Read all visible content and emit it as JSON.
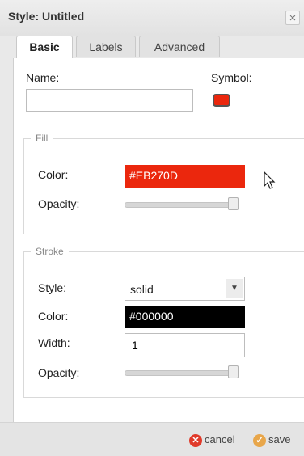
{
  "window": {
    "title": "Style: Untitled",
    "close_glyph": "×"
  },
  "tabs": [
    {
      "label": "Basic",
      "active": true
    },
    {
      "label": "Labels",
      "active": false
    },
    {
      "label": "Advanced",
      "active": false
    }
  ],
  "basic": {
    "name_label": "Name:",
    "name_value": "",
    "symbol_label": "Symbol:",
    "symbol_color": "#EB270D"
  },
  "fill": {
    "legend": "Fill",
    "color_label": "Color:",
    "color_value": "#EB270D",
    "opacity_label": "Opacity:",
    "opacity": 1.0
  },
  "stroke": {
    "legend": "Stroke",
    "style_label": "Style:",
    "style_value": "solid",
    "color_label": "Color:",
    "color_value": "#000000",
    "width_label": "Width:",
    "width_value": "1",
    "opacity_label": "Opacity:",
    "opacity": 1.0
  },
  "footer": {
    "cancel_label": "cancel",
    "save_label": "save"
  },
  "icons": {
    "close": "close-icon",
    "dropdown": "chevron-down-icon",
    "cancel": "cancel-icon",
    "save": "save-icon",
    "cursor": "mouse-cursor-icon"
  }
}
